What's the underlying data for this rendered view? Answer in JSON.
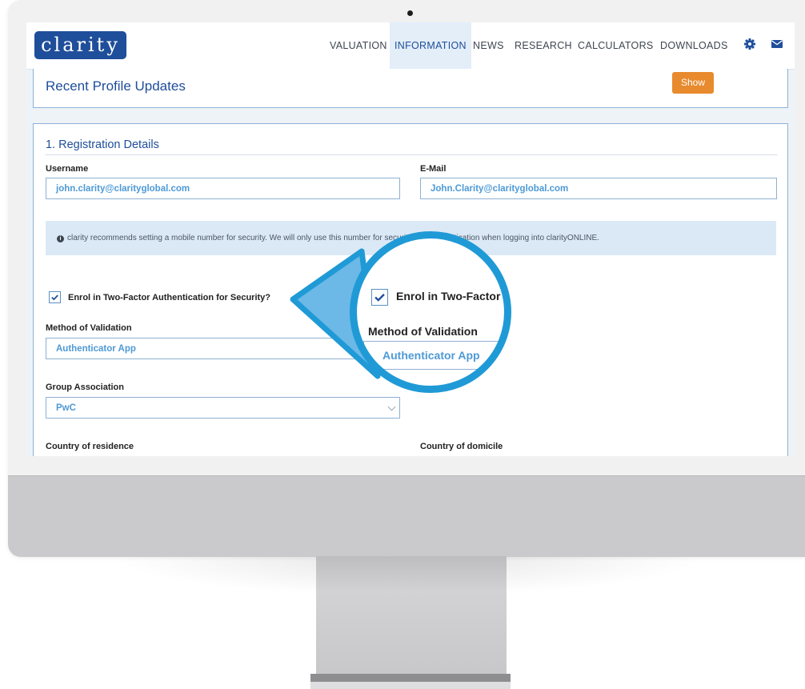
{
  "brand": {
    "logo_text": "clarity"
  },
  "nav": {
    "items": [
      {
        "label": "VALUATION",
        "active": false
      },
      {
        "label": "INFORMATION",
        "active": true
      },
      {
        "label": "NEWS",
        "active": false
      },
      {
        "label": "RESEARCH",
        "active": false
      },
      {
        "label": "CALCULATORS",
        "active": false
      },
      {
        "label": "DOWNLOADS",
        "active": false
      }
    ],
    "icons": [
      "gear-icon",
      "envelope-icon"
    ]
  },
  "recent_updates": {
    "title": "Recent Profile Updates",
    "show_label": "Show"
  },
  "registration": {
    "section_title": "1. Registration Details",
    "username_label": "Username",
    "username_value": "john.clarity@clarityglobal.com",
    "email_label": "E-Mail",
    "email_value": "John.Clarity@clarityglobal.com",
    "info_text": "clarity recommends setting a mobile number for security. We will only use this number for security and authentication when logging into clarityONLINE.",
    "two_factor_label": "Enrol in Two-Factor Authentication for Security?",
    "two_factor_checked": true,
    "method_label": "Method of Validation",
    "method_value": "Authenticator App",
    "group_label": "Group Association",
    "group_value": "PwC",
    "country_residence_label": "Country of residence",
    "country_domicile_label": "Country of domicile"
  },
  "magnifier": {
    "checkbox_label": "Enrol in Two-Factor",
    "method_label": "Method of Validation",
    "method_value": "Authenticator App"
  },
  "colors": {
    "brand_blue": "#1f4e9a",
    "link_blue": "#4d9ad6",
    "accent_orange": "#e88a2e",
    "callout_blue": "#1f9ad6",
    "info_bg": "#dbe9f6"
  }
}
